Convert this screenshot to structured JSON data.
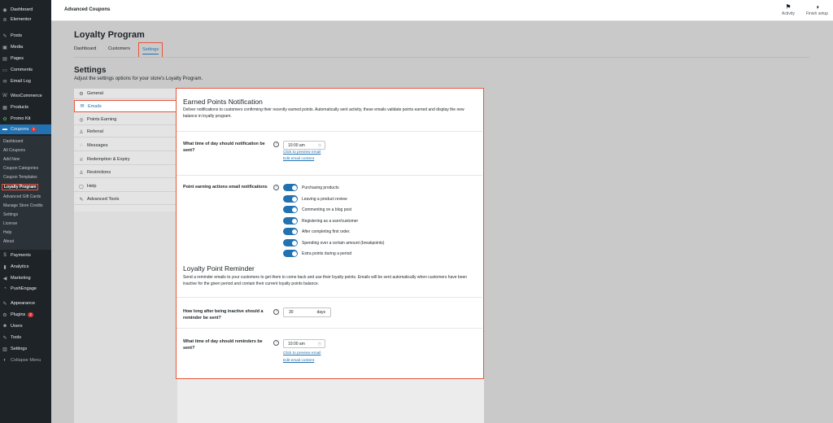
{
  "sidebar": {
    "items": [
      {
        "label": "Dashboard",
        "icon": "dashboard-icon"
      },
      {
        "label": "Elementor",
        "icon": "elementor-icon"
      },
      {
        "label": "Posts",
        "icon": "pin-icon"
      },
      {
        "label": "Media",
        "icon": "media-icon"
      },
      {
        "label": "Pages",
        "icon": "pages-icon"
      },
      {
        "label": "Comments",
        "icon": "comments-icon"
      },
      {
        "label": "Email Log",
        "icon": "email-icon"
      },
      {
        "label": "WooCommerce",
        "icon": "woocommerce-icon"
      },
      {
        "label": "Products",
        "icon": "products-icon"
      },
      {
        "label": "Promo Kit",
        "icon": "promo-icon"
      },
      {
        "label": "Coupons",
        "icon": "coupon-icon",
        "badge": "1"
      },
      {
        "label": "Payments",
        "icon": "payments-icon"
      },
      {
        "label": "Analytics",
        "icon": "analytics-icon"
      },
      {
        "label": "Marketing",
        "icon": "marketing-icon"
      },
      {
        "label": "PushEngage",
        "icon": "pushengage-icon"
      },
      {
        "label": "Appearance",
        "icon": "appearance-icon"
      },
      {
        "label": "Plugins",
        "icon": "plugins-icon",
        "badge": "2"
      },
      {
        "label": "Users",
        "icon": "users-icon"
      },
      {
        "label": "Tools",
        "icon": "tools-icon"
      },
      {
        "label": "Settings",
        "icon": "settings-icon"
      },
      {
        "label": "Collapse Menu",
        "icon": "collapse-icon"
      }
    ],
    "submenu": [
      "Dashboard",
      "All Coupons",
      "Add New",
      "Coupon Categories",
      "Coupon Templates",
      "Loyalty Program",
      "Advanced Gift Cards",
      "Manage Store Credits",
      "Settings",
      "License",
      "Help",
      "About"
    ]
  },
  "topbar": {
    "brand": "Advanced Coupons",
    "activity": "Activity",
    "finish_setup": "Finish setup"
  },
  "page": {
    "title": "Loyalty Program",
    "tabs": [
      "Dashboard",
      "Customers",
      "Settings"
    ]
  },
  "settings": {
    "title": "Settings",
    "subtitle": "Adjust the settings options for your store's Loyalty Program.",
    "nav": [
      {
        "label": "General",
        "icon": "gear-icon"
      },
      {
        "label": "Emails",
        "icon": "envelope-icon"
      },
      {
        "label": "Points Earning",
        "icon": "coin-icon"
      },
      {
        "label": "Referral",
        "icon": "person-icon"
      },
      {
        "label": "Messages",
        "icon": "message-icon"
      },
      {
        "label": "Redemption & Expiry",
        "icon": "trophy-icon"
      },
      {
        "label": "Restrictions",
        "icon": "restriction-icon"
      },
      {
        "label": "Help",
        "icon": "help-icon"
      },
      {
        "label": "Advanced Tools",
        "icon": "wrench-icon"
      }
    ]
  },
  "earned": {
    "title": "Earned Points Notification",
    "description": "Deliver notifications to customers confirming their recently earned points. Automatically sent activity, these emails validate points earned and display the new balance in loyalty program.",
    "time_label": "What time of day should notification be sent?",
    "time_value": "10:00 am",
    "preview_link": "Click to preview email",
    "edit_link": "Edit email content",
    "actions_label": "Point earning actions email notifications",
    "actions": [
      "Purchasing products",
      "Leaving a product review",
      "Commenting on a blog post",
      "Registering as a user/customer",
      "After completing first order.",
      "Spending over a certain amount (breakpoints)",
      "Extra points during a period"
    ]
  },
  "reminder": {
    "title": "Loyalty Point Reminder",
    "description": "Send a reminder emails to your customers to get them to come back and use their loyalty points. Emails will be sent automatically when customers have been inactive for the given period and contain their current loyalty points balance.",
    "inactive_label": "How long after being inactive should a reminder be sent?",
    "inactive_value": "30",
    "inactive_unit": "days",
    "time_label": "What time of day should reminders be sent?",
    "time_value": "10:00 am",
    "preview_link": "Click to preview email",
    "edit_link": "Edit email content"
  },
  "colors": {
    "accent": "#2271b1",
    "highlight": "#e8553b",
    "sidebar": "#1d2327"
  }
}
